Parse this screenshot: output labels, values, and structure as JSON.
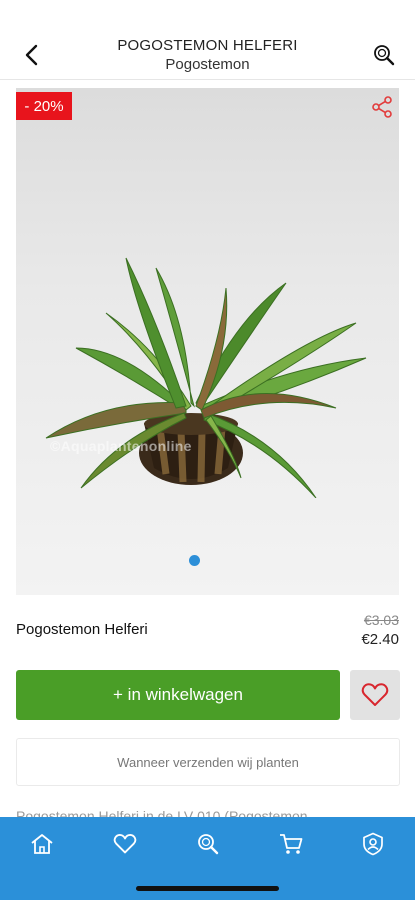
{
  "header": {
    "title": "POGOSTEMON HELFERI",
    "subtitle": "Pogostemon",
    "back_icon": "chevron-left-icon",
    "search_icon": "search-icon"
  },
  "image": {
    "discount_label": "- 20%",
    "share_icon": "share-icon",
    "watermark": "©Aquaplantenonline",
    "carousel": {
      "count": 1,
      "active": 1
    }
  },
  "product": {
    "name": "Pogostemon Helferi",
    "price_old": "€3.03",
    "price_new": "€2.40"
  },
  "actions": {
    "add_to_cart_label": "+ in winkelwagen",
    "favorite_icon": "heart-icon"
  },
  "shipping": {
    "label": "Wanneer verzenden wij planten"
  },
  "description_peek": "Pogostemon Helferi in de LV 010 (Pogostemon ...",
  "bottom_nav": [
    {
      "icon": "home-icon"
    },
    {
      "icon": "heart-icon"
    },
    {
      "icon": "search-icon"
    },
    {
      "icon": "cart-icon"
    },
    {
      "icon": "account-icon"
    }
  ],
  "colors": {
    "accent_blue": "#2b90d9",
    "cart_green": "#4a9e27",
    "discount_red": "#e8141c"
  }
}
